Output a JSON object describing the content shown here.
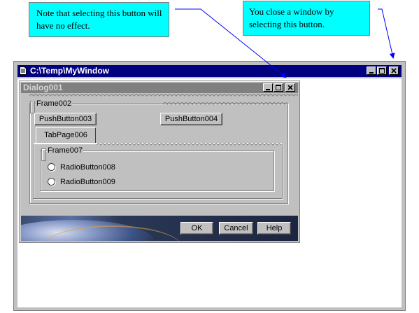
{
  "callouts": {
    "left": "Note that selecting this button will have no effect.",
    "right": "You close a window by selecting this button."
  },
  "main_window": {
    "title": "C:\\Temp\\MyWindow",
    "icon": "document-icon",
    "controls": [
      "minimize-icon",
      "maximize-icon",
      "close-icon"
    ]
  },
  "dialog": {
    "title": "Dialog001",
    "controls": [
      "minimize-icon",
      "maximize-icon",
      "close-icon"
    ],
    "frame002": {
      "label": "Frame002",
      "push_button_1": "PushButton003",
      "push_button_2": "PushButton004"
    },
    "tab": {
      "label": "TabPage006",
      "frame007": {
        "label": "Frame007",
        "radio_1": "RadioButton008",
        "radio_2": "RadioButton009"
      }
    },
    "buttons": {
      "ok": "OK",
      "cancel": "Cancel",
      "help": "Help"
    }
  },
  "colors": {
    "callout_bg": "#00ffff",
    "active_titlebar": "#000080",
    "inactive_titlebar": "#808080",
    "arrow": "#0000ff",
    "face": "#c0c0c0"
  }
}
